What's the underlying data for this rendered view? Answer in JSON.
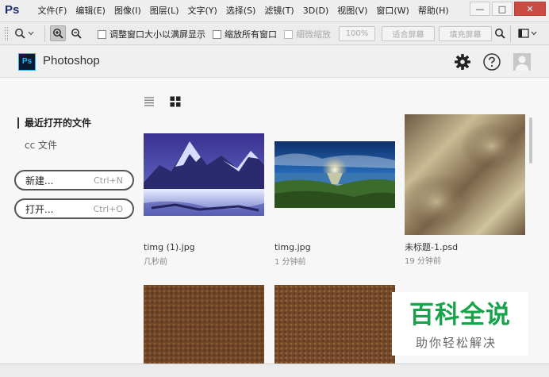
{
  "app": {
    "logo_text": "Ps",
    "menu": [
      "文件(F)",
      "编辑(E)",
      "图像(I)",
      "图层(L)",
      "文字(Y)",
      "选择(S)",
      "滤镜(T)",
      "3D(D)",
      "视图(V)",
      "窗口(W)",
      "帮助(H)"
    ]
  },
  "window_controls": {
    "minimize": "—",
    "maximize": "□",
    "close": "✕"
  },
  "options_bar": {
    "resize_windows_label": "调整窗口大小以满屏显示",
    "zoom_all_label": "缩放所有窗口",
    "scrubby_zoom_label": "细微缩放",
    "zoom_percent_label": "100%",
    "fit_screen_label": "适合屏幕",
    "fill_screen_label": "填充屏幕"
  },
  "home": {
    "logo_text": "Ps",
    "title": "Photoshop"
  },
  "sidebar": {
    "recent_files_label": "最近打开的文件",
    "cc_files_label": "cc 文件",
    "new_button": {
      "label": "新建...",
      "shortcut": "Ctrl+N"
    },
    "open_button": {
      "label": "打开...",
      "shortcut": "Ctrl+O"
    }
  },
  "recent_files": [
    {
      "name": "timg (1).jpg",
      "time": "几秒前"
    },
    {
      "name": "timg.jpg",
      "time": "1 分钟前"
    },
    {
      "name": "未标题-1.psd",
      "time": "19 分钟前"
    }
  ],
  "watermark": {
    "big": "百科全说",
    "small": "助你轻松解决"
  },
  "colors": {
    "accent_ps_blue": "#29b6f6",
    "watermark_green": "#16a34a",
    "close_button": "#c94b44"
  }
}
